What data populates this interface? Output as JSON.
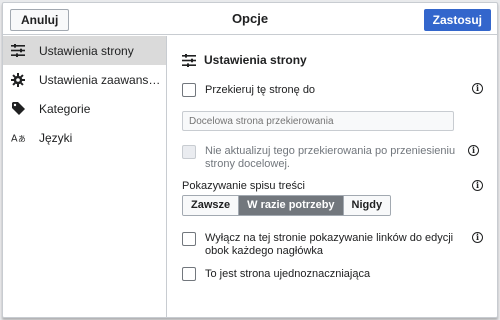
{
  "header": {
    "cancel_label": "Anuluj",
    "title": "Opcje",
    "apply_label": "Zastosuj"
  },
  "sidebar": {
    "items": [
      {
        "label": "Ustawienia strony",
        "icon": "sliders-icon",
        "active": true
      },
      {
        "label": "Ustawienia zaawansowa…",
        "icon": "gear-icon",
        "active": false
      },
      {
        "label": "Kategorie",
        "icon": "tag-icon",
        "active": false
      },
      {
        "label": "Języki",
        "icon": "language-icon",
        "active": false
      }
    ]
  },
  "main": {
    "section_title": "Ustawienia strony",
    "redirect_label": "Przekieruj tę stronę do",
    "redirect_placeholder": "Docelowa strona przekierowania",
    "no_update_label": "Nie aktualizuj tego przekierowania po przeniesieniu strony docelowej.",
    "toc_label": "Pokazywanie spisu treści",
    "toc_options": [
      "Zawsze",
      "W razie potrzeby",
      "Nigdy"
    ],
    "toc_selected": "W razie potrzeby",
    "disable_edit_links_label": "Wyłącz na tej stronie pokazywanie linków do edycji obok każdego nagłówka",
    "disambig_label": "To jest strona ujednoznaczniająca"
  },
  "colors": {
    "accent": "#3366cc",
    "active_nav": "#dadada",
    "segment_selected": "#72777d"
  }
}
